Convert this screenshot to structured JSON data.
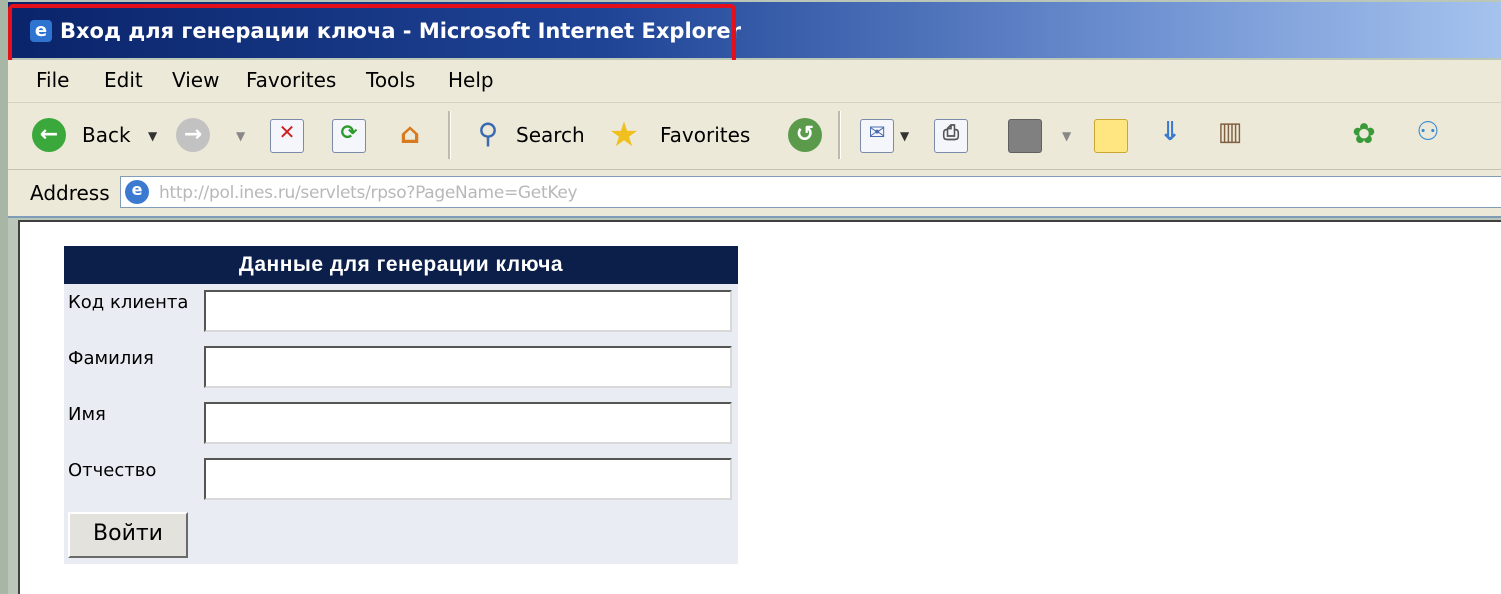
{
  "window": {
    "title": "Вход для генерации ключа - Microsoft Internet Explorer",
    "highlight_color": "#e3101c"
  },
  "menu": [
    "File",
    "Edit",
    "View",
    "Favorites",
    "Tools",
    "Help"
  ],
  "toolbar": {
    "back_label": "Back",
    "search_label": "Search",
    "favorites_label": "Favorites"
  },
  "address": {
    "label": "Address",
    "url": "http://pol.ines.ru/servlets/rpso?PageName=GetKey"
  },
  "form": {
    "header": "Данные для генерации ключа",
    "header_color": "#0c1f4a",
    "fields": [
      {
        "label": "Код клиента",
        "value": ""
      },
      {
        "label": "Фамилия",
        "value": ""
      },
      {
        "label": "Имя",
        "value": ""
      },
      {
        "label": "Отчество",
        "value": ""
      }
    ],
    "submit_label": "Войти"
  }
}
